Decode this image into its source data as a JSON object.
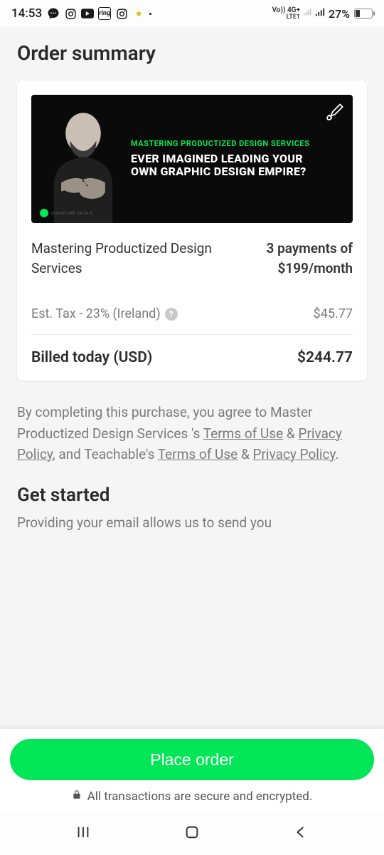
{
  "status": {
    "time": "14:53",
    "network_label": "Vo)) 4G+",
    "network_sub": "LTE1",
    "battery_pct": "27%"
  },
  "order": {
    "title": "Order summary",
    "banner_subtitle": "MASTERING PRODUCTIZED DESIGN SERVICES",
    "banner_headline": "EVER IMAGINED LEADING YOUR OWN GRAPHIC DESIGN EMPIRE?",
    "banner_connect": "connect with me on X",
    "item_name": "Mastering Productized Design Services",
    "item_price_line1": "3 payments of",
    "item_price_line2": "$199/month",
    "tax_label": "Est. Tax - 23% (Ireland)",
    "tax_amount": "$45.77",
    "total_label": "Billed today (USD)",
    "total_amount": "$244.77"
  },
  "terms": {
    "prefix": "By completing this purchase, you agree to Master Productized Design Services 's ",
    "terms1": "Terms of Use",
    "amp": " & ",
    "privacy1": "Privacy Policy",
    "mid": ", and Teachable's ",
    "terms2": "Terms of Use",
    "privacy2": "Privacy Policy",
    "suffix": "."
  },
  "get_started": {
    "title": "Get started",
    "subtitle": "Providing your email allows us to send you"
  },
  "footer": {
    "place_order": "Place order",
    "secure": "All transactions are secure and encrypted."
  }
}
